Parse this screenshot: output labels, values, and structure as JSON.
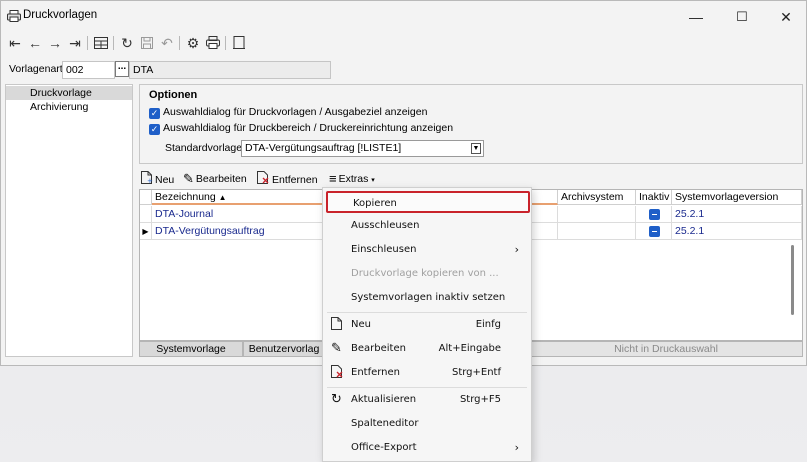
{
  "window": {
    "title": "Druckvorlagen",
    "controls": {
      "minimize": "—",
      "maximize": "☐",
      "close": "✕"
    }
  },
  "toolbar": {
    "icons": [
      "first-record-icon",
      "prev-icon",
      "next-icon",
      "last-record-icon",
      "table-view-icon",
      "refresh-icon",
      "save-icon",
      "undo-icon",
      "settings-icon",
      "print-icon",
      "exit-icon"
    ]
  },
  "fields": {
    "vorlagenart_label": "Vorlagenart",
    "vorlagenart_value": "002",
    "lookup_label": "...",
    "vorlagenart_desc": "DTA"
  },
  "sidebar": {
    "items": [
      {
        "label": "Druckvorlage",
        "selected": true
      },
      {
        "label": "Archivierung",
        "selected": false
      }
    ]
  },
  "options": {
    "title": "Optionen",
    "check1": "Auswahldialog für Druckvorlagen / Ausgabeziel anzeigen",
    "check2": "Auswahldialog für Druckbereich / Druckereinrichtung anzeigen",
    "standard_label": "Standardvorlage",
    "standard_value": "DTA-Vergütungsauftrag [!LISTE1]"
  },
  "grid_toolbar": {
    "new": "Neu",
    "edit": "Bearbeiten",
    "remove": "Entfernen",
    "extras": "Extras"
  },
  "grid": {
    "columns": {
      "bezeichnung": "Bezeichnung",
      "archivsystem": "Archivsystem",
      "inaktiv": "Inaktiv",
      "version": "Systemvorlageversion"
    },
    "rows": [
      {
        "name": "DTA-Journal",
        "version": "25.2.1",
        "current": false
      },
      {
        "name": "DTA-Vergütungsauftrag",
        "version": "25.2.1",
        "current": true
      }
    ]
  },
  "bottom_tabs": {
    "systemvorlage": "Systemvorlage",
    "benutzervorlage": "Benutzervorlag",
    "nicht_druck": "Nicht in Druckauswahl"
  },
  "context_menu": {
    "kopieren": "Kopieren",
    "ausschleusen": "Ausschleusen",
    "einschleusen": "Einschleusen",
    "kopieren_von": "Druckvorlage kopieren von ...",
    "inaktiv_setzen": "Systemvorlagen inaktiv setzen",
    "neu": "Neu",
    "neu_shortcut": "Einfg",
    "bearbeiten": "Bearbeiten",
    "bearbeiten_shortcut": "Alt+Eingabe",
    "entfernen": "Entfernen",
    "entfernen_shortcut": "Strg+Entf",
    "aktualisieren": "Aktualisieren",
    "aktualisieren_shortcut": "Strg+F5",
    "spalteneditor": "Spalteneditor",
    "office_export": "Office-Export"
  },
  "colors": {
    "accent": "#1f5fc8",
    "highlight_border": "#c9232b",
    "row_text": "#1a2a8e"
  }
}
